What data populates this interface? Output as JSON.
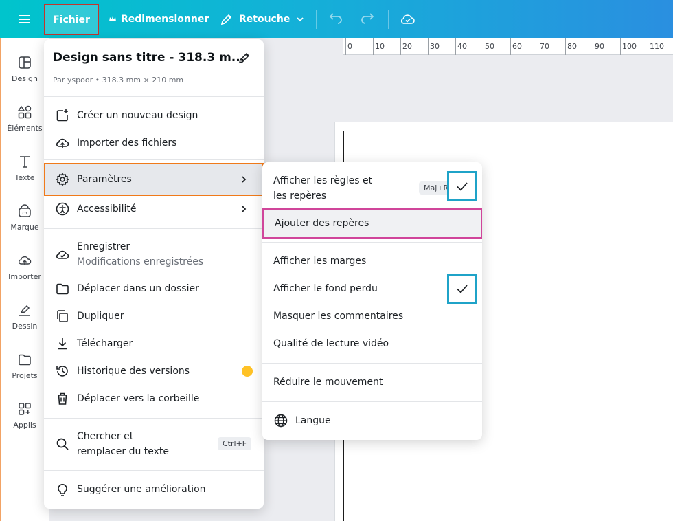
{
  "topbar": {
    "file_label": "Fichier",
    "resize_label": "Redimensionner",
    "edit_label": "Retouche"
  },
  "sidebar": {
    "items": [
      {
        "label": "Design"
      },
      {
        "label": "Éléments"
      },
      {
        "label": "Texte"
      },
      {
        "label": "Marque"
      },
      {
        "label": "Importer"
      },
      {
        "label": "Dessin"
      },
      {
        "label": "Projets"
      },
      {
        "label": "Applis"
      }
    ]
  },
  "ruler": {
    "labels": [
      "0",
      "10",
      "20",
      "30",
      "40",
      "50",
      "60",
      "70",
      "80",
      "90",
      "100",
      "110"
    ]
  },
  "menu": {
    "title": "Design sans titre - 318.3 m...",
    "subtitle": "Par yspoor • 318.3 mm × 210 mm",
    "items": {
      "new_design": "Créer un nouveau design",
      "import_files": "Importer des fichiers",
      "settings": "Paramètres",
      "accessibility": "Accessibilité",
      "save": "Enregistrer",
      "save_status": "Modifications enregistrées",
      "move_folder": "Déplacer dans un dossier",
      "duplicate": "Dupliquer",
      "download": "Télécharger",
      "version_history": "Historique des versions",
      "trash": "Déplacer vers la corbeille",
      "find_replace_1": "Chercher et",
      "find_replace_2": "remplacer du texte",
      "find_replace_shortcut": "Ctrl+F",
      "suggest": "Suggérer une amélioration"
    }
  },
  "submenu": {
    "items": {
      "rulers_1": "Afficher les règles et",
      "rulers_2": "les repères",
      "rulers_shortcut": "Maj+R",
      "add_guides": "Ajouter des repères",
      "margins": "Afficher les marges",
      "bleed": "Afficher le fond perdu",
      "hide_comments": "Masquer les commentaires",
      "video_quality": "Qualité de lecture vidéo",
      "reduce_motion": "Réduire le mouvement",
      "language": "Langue"
    }
  }
}
